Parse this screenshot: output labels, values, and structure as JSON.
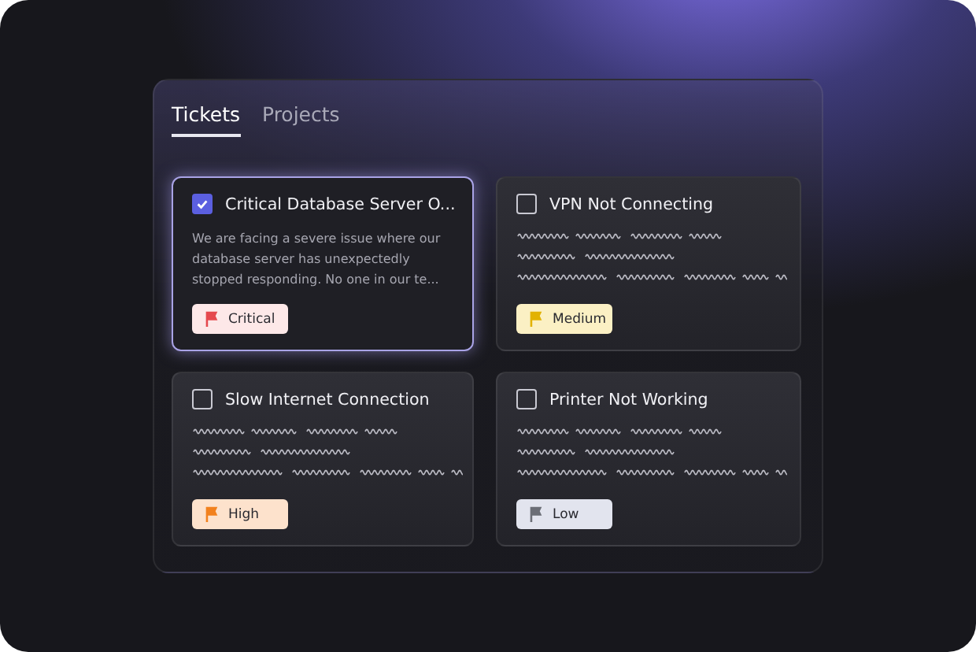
{
  "tabs": [
    {
      "label": "Tickets",
      "selected": true
    },
    {
      "label": "Projects",
      "selected": false
    }
  ],
  "tickets": [
    {
      "title": "Critical Database Server O...",
      "checked": true,
      "selected": true,
      "description": "We are facing a severe issue where our database server has unexpectedly stopped responding. No one in our te...",
      "priority": "Critical",
      "color": "#e5484d"
    },
    {
      "title": "VPN Not Connecting",
      "checked": false,
      "selected": false,
      "priority": "Medium",
      "color": "#e2b203"
    },
    {
      "title": "Slow Internet Connection",
      "checked": false,
      "selected": false,
      "priority": "High",
      "color": "#f2811d"
    },
    {
      "title": "Printer Not Working",
      "checked": false,
      "selected": false,
      "priority": "Low",
      "color": "#6b6e76"
    }
  ]
}
